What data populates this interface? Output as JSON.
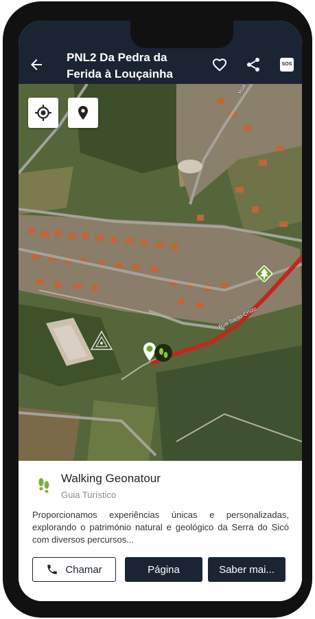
{
  "header": {
    "title_line1": "PNL2 Da Pedra da",
    "title_line2": "Ferida à Louçainha",
    "sos_label": "SOS"
  },
  "map": {
    "road_label_1": "Rua Mo...",
    "road_label_2": "Rua Santo Cristo"
  },
  "card": {
    "name": "Walking Geonatour",
    "type": "Guia Turístico",
    "description": "Proporcionamos experiências únicas e personalizadas, explorando o património natural e geológico da Serra do Sicó com diversos percursos...",
    "buttons": {
      "call": "Chamar",
      "page": "Página",
      "more": "Saber mai..."
    }
  },
  "colors": {
    "header_bg": "#1b2433",
    "route": "#c0281e",
    "accent_green": "#6aa42f"
  }
}
